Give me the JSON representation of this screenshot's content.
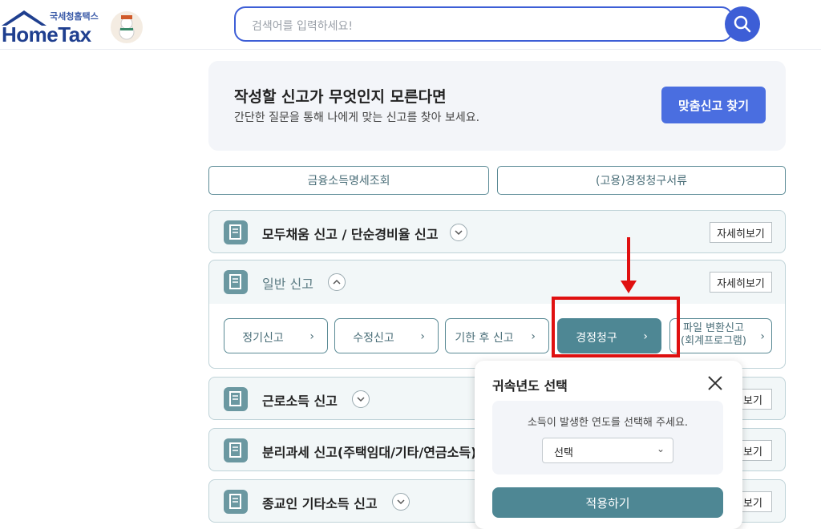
{
  "header": {
    "logo_sub": "국세청홈택스",
    "logo_main": "HomeTax",
    "search_placeholder": "검색어를 입력하세요!"
  },
  "banner": {
    "title": "작성할 신고가 무엇인지 모른다면",
    "subtitle": "간단한 질문을 통해 나에게 맞는 신고를 찾아 보세요.",
    "button": "맞춤신고 찾기"
  },
  "quick_links": [
    "금융소득명세조회",
    "(고용)경정청구서류"
  ],
  "cards": [
    {
      "title": "모두채움 신고 / 단순경비율 신고",
      "detail": "자세히보기"
    },
    {
      "title": "일반 신고",
      "detail": "자세히보기",
      "sub_buttons": [
        "정기신고",
        "수정신고",
        "기한 후 신고",
        "경정청구",
        "파일 변환신고\n(회계프로그램)"
      ]
    },
    {
      "title": "근로소득 신고",
      "detail": "보기"
    },
    {
      "title": "분리과세 신고(주택임대/기타/연금소득)",
      "detail": "보기"
    },
    {
      "title": "종교인 기타소득 신고",
      "detail": "보기"
    }
  ],
  "popup": {
    "title": "귀속년도 선택",
    "description": "소득이 발생한 연도를 선택해 주세요.",
    "select_value": "선택",
    "apply": "적용하기"
  },
  "colors": {
    "primary": "#3d5ed6",
    "teal": "#4e8794",
    "annotation": "#e01010"
  }
}
